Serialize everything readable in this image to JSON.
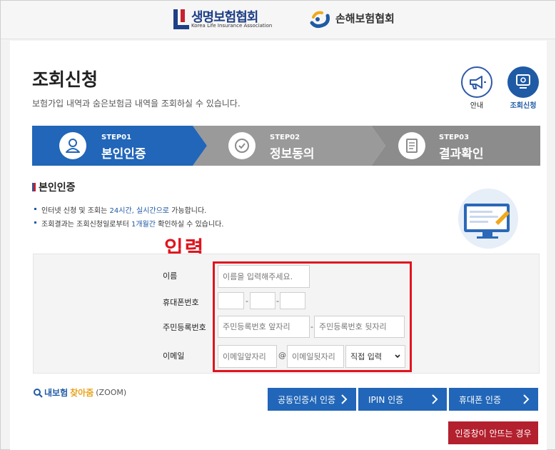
{
  "header": {
    "logo1_name": "생명보험협회",
    "logo1_sub": "Korea Life Insurance Association",
    "logo2_name": "손해보험협회"
  },
  "page": {
    "title": "조회신청",
    "description": "보험가입 내역과 숨은보험금 내역을 조회하실 수 있습니다."
  },
  "shortcuts": {
    "guide_label": "안내",
    "inquiry_label": "조회신청"
  },
  "steps": [
    {
      "num": "STEP01",
      "label": "본인인증"
    },
    {
      "num": "STEP02",
      "label": "정보동의"
    },
    {
      "num": "STEP03",
      "label": "결과확인"
    }
  ],
  "section": {
    "title": "본인인증",
    "note1_a": "인터넷 신청 및 조회는 ",
    "note1_b": "24시간, 실시간으로",
    "note1_c": " 가능합니다.",
    "note2_a": "조회결과는 조회신청일로부터 ",
    "note2_b": "1개월간",
    "note2_c": " 확인하실 수 있습니다."
  },
  "annotation": "입력",
  "form": {
    "name_label": "이름",
    "name_placeholder": "이름을 입력해주세요.",
    "phone_label": "휴대폰번호",
    "phone_sep1": "-",
    "phone_sep2": "-",
    "rrn_label": "주민등록번호",
    "rrn_front_placeholder": "주민등록번호 앞자리",
    "rrn_sep": "-",
    "rrn_back_placeholder": "주민등록번호 뒷자리",
    "email_label": "이메일",
    "email_id_placeholder": "이메일앞자리",
    "email_at": "@",
    "email_domain_placeholder": "이메일뒷자리",
    "email_select_value": "직접 입력"
  },
  "zoom": {
    "part1": "내보험",
    "part2": "찾아줌",
    "part3": "(ZOOM)"
  },
  "buttons": {
    "cert": "공동인증서 인증",
    "ipin": "IPIN 인증",
    "phone": "휴대폰 인증",
    "fail": "인증창이 안뜨는 경우"
  },
  "colors": {
    "brand_blue": "#2166b8",
    "step_active": "#2166b8",
    "step_inactive": "#8c8c8c",
    "accent_red": "#e0141e",
    "fail_button": "#b3202e"
  }
}
